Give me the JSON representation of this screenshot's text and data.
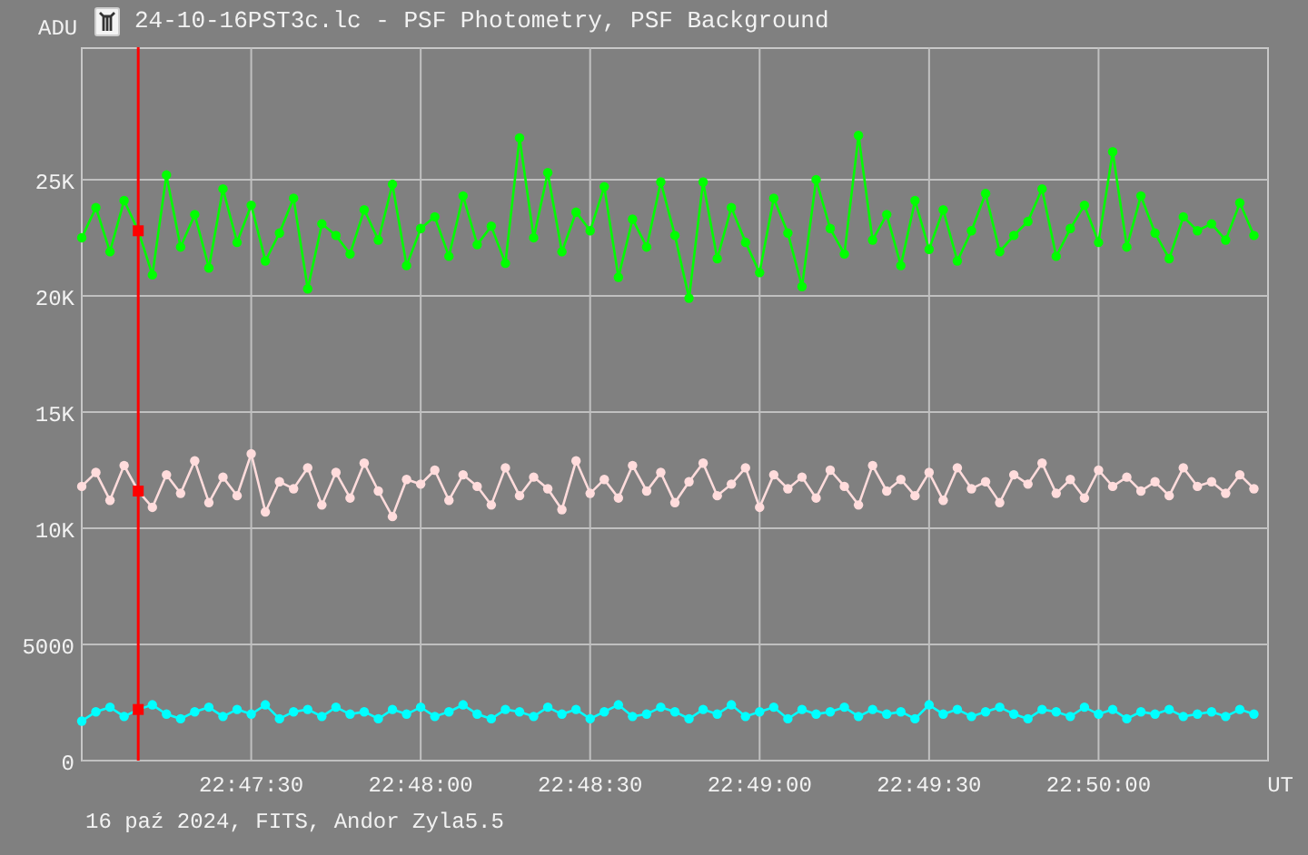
{
  "window": {
    "title": "24-10-16PST3c.lc - PSF Photometry, PSF Background"
  },
  "plot": {
    "y_unit": "ADU",
    "x_unit": "UT",
    "chart_data": {
      "type": "line",
      "grid": true,
      "ylim": [
        0,
        30700
      ],
      "yticks": [
        {
          "value": 0,
          "label": "0"
        },
        {
          "value": 5000,
          "label": "5000"
        },
        {
          "value": 10000,
          "label": "10K"
        },
        {
          "value": 15000,
          "label": "15K"
        },
        {
          "value": 20000,
          "label": "20K"
        },
        {
          "value": 25000,
          "label": "25K"
        }
      ],
      "categories": [
        null,
        null,
        null,
        null,
        null,
        null,
        null,
        null,
        null,
        null,
        null,
        null,
        "22:47:30",
        null,
        null,
        null,
        null,
        null,
        null,
        null,
        null,
        null,
        null,
        null,
        "22:48:00",
        null,
        null,
        null,
        null,
        null,
        null,
        null,
        null,
        null,
        null,
        null,
        "22:48:30",
        null,
        null,
        null,
        null,
        null,
        null,
        null,
        null,
        null,
        null,
        null,
        "22:49:00",
        null,
        null,
        null,
        null,
        null,
        null,
        null,
        null,
        null,
        null,
        null,
        "22:49:30",
        null,
        null,
        null,
        null,
        null,
        null,
        null,
        null,
        null,
        null,
        null,
        "22:50:00",
        null,
        null,
        null,
        null,
        null,
        null,
        null,
        null,
        null,
        null,
        null
      ],
      "series": [
        {
          "color": "#00ff00",
          "marker": "circle",
          "values": [
            22500,
            23800,
            21900,
            24100,
            22800,
            20900,
            25200,
            22100,
            23500,
            21200,
            24600,
            22300,
            23900,
            21500,
            22700,
            24200,
            20300,
            23100,
            22600,
            21800,
            23700,
            22400,
            24800,
            21300,
            22900,
            23400,
            21700,
            24300,
            22200,
            23000,
            21400,
            26800,
            22500,
            25300,
            21900,
            23600,
            22800,
            24700,
            20800,
            23300,
            22100,
            24900,
            22600,
            19900,
            24900,
            21600,
            23800,
            22300,
            21000,
            24200,
            22700,
            20400,
            25000,
            22900,
            21800,
            26900,
            22400,
            23500,
            21300,
            24100,
            22000,
            23700,
            21500,
            22800,
            24400,
            21900,
            22600,
            23200,
            24600,
            21700,
            22900,
            23900,
            22300,
            26200,
            22100,
            24300,
            22700,
            21600,
            23400,
            22800,
            23100,
            22400,
            24000,
            22600
          ]
        },
        {
          "color": "#ffdcdc",
          "marker": "circle",
          "values": [
            11800,
            12400,
            11200,
            12700,
            11600,
            10900,
            12300,
            11500,
            12900,
            11100,
            12200,
            11400,
            13200,
            10700,
            12000,
            11700,
            12600,
            11000,
            12400,
            11300,
            12800,
            11600,
            10500,
            12100,
            11900,
            12500,
            11200,
            12300,
            11800,
            11000,
            12600,
            11400,
            12200,
            11700,
            10800,
            12900,
            11500,
            12100,
            11300,
            12700,
            11600,
            12400,
            11100,
            12000,
            12800,
            11400,
            11900,
            12600,
            10900,
            12300,
            11700,
            12200,
            11300,
            12500,
            11800,
            11000,
            12700,
            11600,
            12100,
            11400,
            12400,
            11200,
            12600,
            11700,
            12000,
            11100,
            12300,
            11900,
            12800,
            11500,
            12100,
            11300,
            12500,
            11800,
            12200,
            11600,
            12000,
            11400,
            12600,
            11800,
            12000,
            11500,
            12300,
            11700
          ]
        },
        {
          "color": "#00ffff",
          "marker": "circle",
          "values": [
            1700,
            2100,
            2300,
            1900,
            2200,
            2400,
            2000,
            1800,
            2100,
            2300,
            1900,
            2200,
            2000,
            2400,
            1800,
            2100,
            2200,
            1900,
            2300,
            2000,
            2100,
            1800,
            2200,
            2000,
            2300,
            1900,
            2100,
            2400,
            2000,
            1800,
            2200,
            2100,
            1900,
            2300,
            2000,
            2200,
            1800,
            2100,
            2400,
            1900,
            2000,
            2300,
            2100,
            1800,
            2200,
            2000,
            2400,
            1900,
            2100,
            2300,
            1800,
            2200,
            2000,
            2100,
            2300,
            1900,
            2200,
            2000,
            2100,
            1800,
            2400,
            2000,
            2200,
            1900,
            2100,
            2300,
            2000,
            1800,
            2200,
            2100,
            1900,
            2300,
            2000,
            2200,
            1800,
            2100,
            2000,
            2200,
            1900,
            2000,
            2100,
            1900,
            2200,
            2000
          ]
        }
      ]
    },
    "cursor": {
      "shown": true
    }
  },
  "status_bar": "16 paź 2024, FITS, Andor Zyla5.5"
}
